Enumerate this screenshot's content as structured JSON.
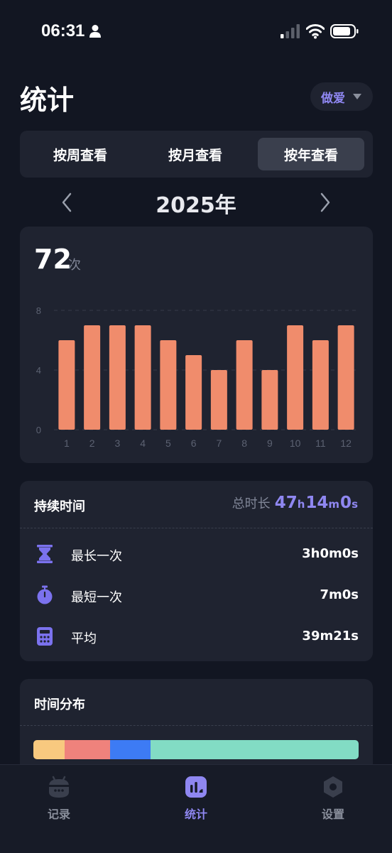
{
  "status_bar": {
    "time": "06:31"
  },
  "header": {
    "title": "统计",
    "category_label": "做爱"
  },
  "segments": [
    {
      "label": "按周查看",
      "active": false
    },
    {
      "label": "按月查看",
      "active": false
    },
    {
      "label": "按年查看",
      "active": true
    }
  ],
  "year_nav": {
    "label": "2025年"
  },
  "summary": {
    "count": "72",
    "unit": "次"
  },
  "chart_data": {
    "type": "bar",
    "categories": [
      "1",
      "2",
      "3",
      "4",
      "5",
      "6",
      "7",
      "8",
      "9",
      "10",
      "11",
      "12"
    ],
    "values": [
      6,
      7,
      7,
      7,
      6,
      5,
      4,
      6,
      4,
      7,
      6,
      7
    ],
    "yticks": [
      "0",
      "4",
      "8"
    ],
    "ylim": [
      0,
      8
    ],
    "grid": true,
    "bar_color": "#f08c6c"
  },
  "duration": {
    "title": "持续时间",
    "total_label": "总时长",
    "total_hours": "47",
    "total_hours_unit": "h",
    "total_minutes": "14",
    "total_minutes_unit": "m",
    "total_seconds": "0",
    "total_seconds_unit": "s",
    "rows": [
      {
        "label": "最长一次",
        "value": "3h0m0s",
        "icon": "hourglass-icon"
      },
      {
        "label": "最短一次",
        "value": "7m0s",
        "icon": "stopwatch-icon"
      },
      {
        "label": "平均",
        "value": "39m21s",
        "icon": "calculator-icon"
      }
    ]
  },
  "distribution": {
    "title": "时间分布",
    "segments": [
      {
        "fraction": 0.096,
        "color": "#f8c97f"
      },
      {
        "fraction": 0.14,
        "color": "#ef827c"
      },
      {
        "fraction": 0.124,
        "color": "#3d7bf4"
      },
      {
        "fraction": 0.64,
        "color": "#82dcc4"
      }
    ]
  },
  "tabs": [
    {
      "label": "记录",
      "icon": "record-icon",
      "active": false
    },
    {
      "label": "统计",
      "icon": "chart-icon",
      "active": true
    },
    {
      "label": "设置",
      "icon": "settings-icon",
      "active": false
    }
  ],
  "colors": {
    "accent": "#8f87f1",
    "background": "#121622",
    "card": "#1f2330"
  }
}
